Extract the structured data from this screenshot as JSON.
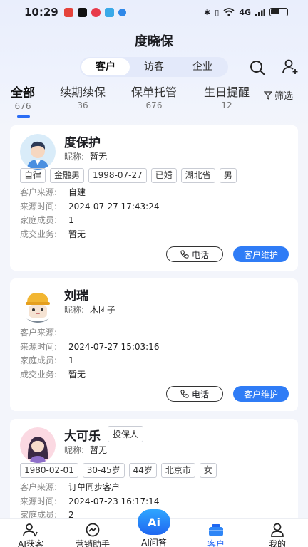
{
  "status_bar": {
    "time": "10:29",
    "network": "4G",
    "colors": {
      "app1": "#e5433b",
      "app2": "#111111",
      "app3": "#e83a4a",
      "app4": "#3aa9e8",
      "app5": "#2f88e8"
    }
  },
  "header": {
    "title": "度晓保"
  },
  "segment": {
    "items": [
      "客户",
      "访客",
      "企业"
    ],
    "active_index": 0
  },
  "filter_tabs": [
    {
      "label": "全部",
      "count": "676"
    },
    {
      "label": "续期续保",
      "count": "36"
    },
    {
      "label": "保单托管",
      "count": "676"
    },
    {
      "label": "生日提醒",
      "count": "12"
    }
  ],
  "filter_label": "筛选",
  "labels": {
    "nickname": "昵称:",
    "source": "客户来源:",
    "source_time": "来源时间:",
    "family": "家庭成员:",
    "deals": "成交业务:",
    "call": "电话",
    "maintain": "客户维护"
  },
  "customers": [
    {
      "name": "度保护",
      "nickname": "暂无",
      "tags": [
        "自律",
        "金融男",
        "1998-07-27",
        "已婚",
        "湖北省",
        "男"
      ],
      "source": "自建",
      "source_time": "2024-07-27 17:43:24",
      "family": "1",
      "deals": "暂无"
    },
    {
      "name": "刘瑞",
      "nickname": "木团子",
      "source": "--",
      "source_time": "2024-07-27 15:03:16",
      "family": "1",
      "deals": "暂无"
    },
    {
      "name": "大可乐",
      "badge": "投保人",
      "nickname": "暂无",
      "tags": [
        "1980-02-01",
        "30-45岁",
        "44岁",
        "北京市",
        "女"
      ],
      "source": "订单同步客户",
      "source_time": "2024-07-23 16:17:14",
      "family": "2"
    }
  ],
  "bottom_nav": [
    {
      "label": "AI获客",
      "icon": "person-icon"
    },
    {
      "label": "营销助手",
      "icon": "chart-icon"
    },
    {
      "label": "AI问答",
      "icon": "ai-icon",
      "center_text": "Ai"
    },
    {
      "label": "客户",
      "icon": "briefcase-icon",
      "active": true
    },
    {
      "label": "我的",
      "icon": "profile-icon"
    }
  ],
  "accent_color": "#2f7cf6"
}
